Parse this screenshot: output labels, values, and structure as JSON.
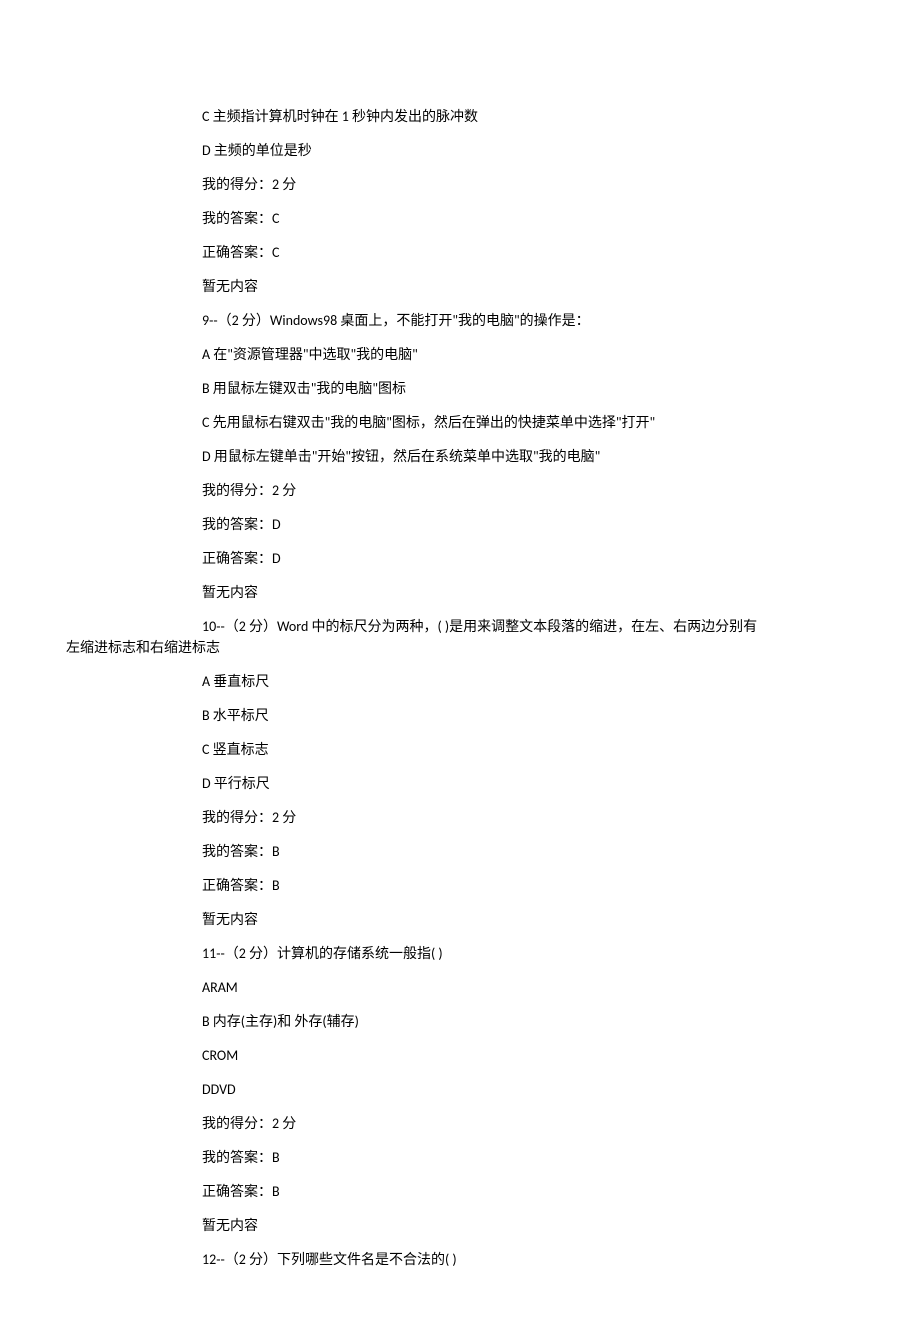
{
  "lines": [
    {
      "text": "C 主频指计算机时钟在 1 秒钟内发出的脉冲数"
    },
    {
      "text": "D 主频的单位是秒"
    },
    {
      "text": "我的得分：2 分"
    },
    {
      "text": "我的答案：C"
    },
    {
      "text": "正确答案：C"
    },
    {
      "text": "暂无内容"
    },
    {
      "text": "9--（2 分）Windows98 桌面上，不能打开\"我的电脑\"的操作是："
    },
    {
      "text": "A 在\"资源管理器\"中选取\"我的电脑\""
    },
    {
      "text": "B 用鼠标左键双击\"我的电脑\"图标"
    },
    {
      "text": "C 先用鼠标右键双击\"我的电脑\"图标，然后在弹出的快捷菜单中选择\"打开\""
    },
    {
      "text": "D 用鼠标左键单击\"开始\"按钮，然后在系统菜单中选取\"我的电脑\""
    },
    {
      "text": "我的得分：2 分"
    },
    {
      "text": "我的答案：D"
    },
    {
      "text": "正确答案：D"
    },
    {
      "text": "暂无内容"
    },
    {
      "text": "10--（2 分）Word 中的标尺分为两种，( )是用来调整文本段落的缩进，在左、右两边分别有"
    },
    {
      "text": "左缩进标志和右缩进标志",
      "outdent": true,
      "continuation": true
    },
    {
      "text": "A 垂直标尺"
    },
    {
      "text": "B 水平标尺"
    },
    {
      "text": "C 竖直标志"
    },
    {
      "text": "D 平行标尺"
    },
    {
      "text": "我的得分：2 分"
    },
    {
      "text": "我的答案：B"
    },
    {
      "text": "正确答案：B"
    },
    {
      "text": "暂无内容"
    },
    {
      "text": "11--（2 分）计算机的存储系统一般指( )"
    },
    {
      "text": "ARAM"
    },
    {
      "text": "B 内存(主存)和 外存(辅存)"
    },
    {
      "text": "CROM"
    },
    {
      "text": "DDVD"
    },
    {
      "text": "我的得分：2 分"
    },
    {
      "text": "我的答案：B"
    },
    {
      "text": "正确答案：B"
    },
    {
      "text": "暂无内容"
    },
    {
      "text": "12--（2 分）下列哪些文件名是不合法的( )"
    }
  ]
}
